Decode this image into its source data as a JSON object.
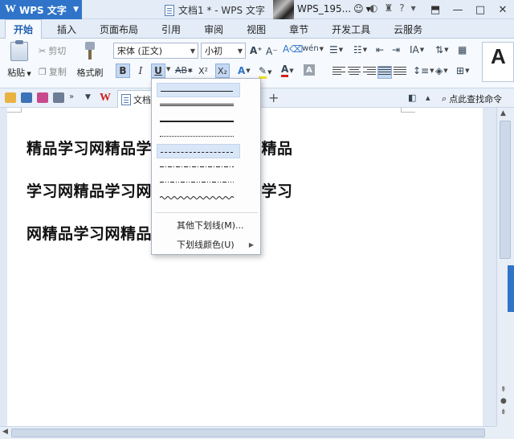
{
  "titlebar": {
    "app_name": "WPS 文字",
    "doc_title": "文档1 * - WPS 文字",
    "user_name": "WPS_195...",
    "icons": [
      "smiley-icon",
      "chevron-down-icon",
      "skin-icon",
      "shirt-icon",
      "help-icon",
      "arrow-icon",
      "restore-icon",
      "minimize-icon",
      "maximize-icon",
      "close-icon"
    ]
  },
  "tabs": [
    "开始",
    "插入",
    "页面布局",
    "引用",
    "审阅",
    "视图",
    "章节",
    "开发工具",
    "云服务"
  ],
  "ribbon": {
    "paste_label": "粘贴",
    "cut_label": "剪切",
    "copy_label": "复制",
    "format_painter_label": "格式刷",
    "font_name": "宋体 (正文)",
    "font_size": "小初",
    "bold": "B",
    "italic": "I",
    "underline": "U",
    "strike": "AB",
    "superscript": "X²",
    "subscript": "X₂",
    "grow_font": "A⁺",
    "shrink_font": "A⁻",
    "phonetic": "wén",
    "style_sample": "A",
    "accent_color": "#2f74c8",
    "font_color": "#d0231b",
    "highlight_color": "#f0e020"
  },
  "quickbar": {
    "doc_tab_label": "文档",
    "find_label": "点此查找命令",
    "wps_mark": "W"
  },
  "document": {
    "lines": [
      "精品学习网精品学习网精品学习网精品",
      "学习网精品学习网精品学习网精品学习",
      "网精品学习网精品学习网"
    ]
  },
  "underline_menu": {
    "styles": [
      "single",
      "double",
      "thick",
      "dotted",
      "dashed",
      "dash-dot",
      "dash-dot-dot",
      "wavy"
    ],
    "other_label": "其他下划线(M)...",
    "color_label": "下划线颜色(U)"
  }
}
